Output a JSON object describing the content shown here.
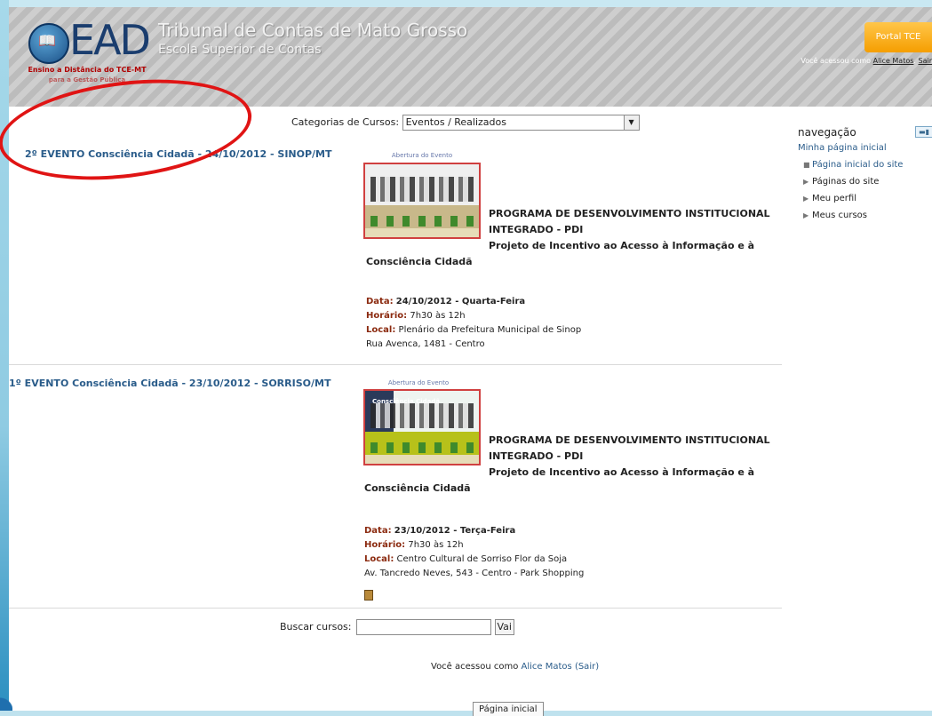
{
  "header": {
    "logo_text": "EAD",
    "logo_sub": "Ensino a Distância do TCE-MT",
    "logo_sub2": "para a Gestão Pública",
    "site_title": "Tribunal de Contas de Mato Grosso",
    "site_subtitle": "Escola Superior de Contas",
    "portal_button": "Portal TCE",
    "login_prefix": "Você acessou como",
    "login_user": "Alice Matos",
    "login_logout": "Sair"
  },
  "categories": {
    "label": "Categorias de Cursos:",
    "selected": "Eventos / Realizados"
  },
  "events": [
    {
      "title": "2º EVENTO Consciência Cidadã - 24/10/2012 - SINOP/MT",
      "image_caption": "Abertura do Evento",
      "program_line1": "PROGRAMA DE DESENVOLVIMENTO INSTITUCIONAL",
      "program_line2": "INTEGRADO - PDI",
      "program_line3": "Projeto de Incentivo ao Acesso à Informação e à",
      "program_line4": "Consciência Cidadã",
      "date_label": "Data:",
      "date_value": "24/10/2012 - Quarta-Feira",
      "time_label": "Horário:",
      "time_value": "7h30 às 12h",
      "place_label": "Local:",
      "place_value": "Plenário da Prefeitura Municipal de Sinop",
      "address": "Rua Avenca, 1481 - Centro"
    },
    {
      "title": "1º EVENTO Consciência Cidadã - 23/10/2012 - SORRISO/MT",
      "image_caption": "Abertura do Evento",
      "image_banner": "Consciência Cidadã",
      "program_line1": "PROGRAMA DE DESENVOLVIMENTO INSTITUCIONAL",
      "program_line2": "INTEGRADO - PDI",
      "program_line3": "Projeto de Incentivo ao Acesso à Informação e à",
      "program_line4": "Consciência Cidadã",
      "date_label": "Data:",
      "date_value": "23/10/2012 - Terça-Feira",
      "time_label": "Horário:",
      "time_value": "7h30 às 12h",
      "place_label": "Local:",
      "place_value": "Centro Cultural de Sorriso Flor da Soja",
      "address": "Av. Tancredo Neves, 543 - Centro - Park Shopping"
    }
  ],
  "search": {
    "label": "Buscar cursos:",
    "button": "Vai",
    "value": ""
  },
  "footer": {
    "login_prefix": "Você acessou como",
    "login_user": "Alice Matos",
    "login_logout": "(Sair)",
    "home_button": "Página inicial"
  },
  "navigation": {
    "title": "navegação",
    "home": "Minha página inicial",
    "items": [
      "Página inicial do site",
      "Páginas do site",
      "Meu perfil",
      "Meus cursos"
    ]
  },
  "colors": {
    "link": "#2a5c8a",
    "label_red": "#8b2a0f",
    "annotation_oval": "#e01414",
    "portal_orange": "#f59e00"
  }
}
